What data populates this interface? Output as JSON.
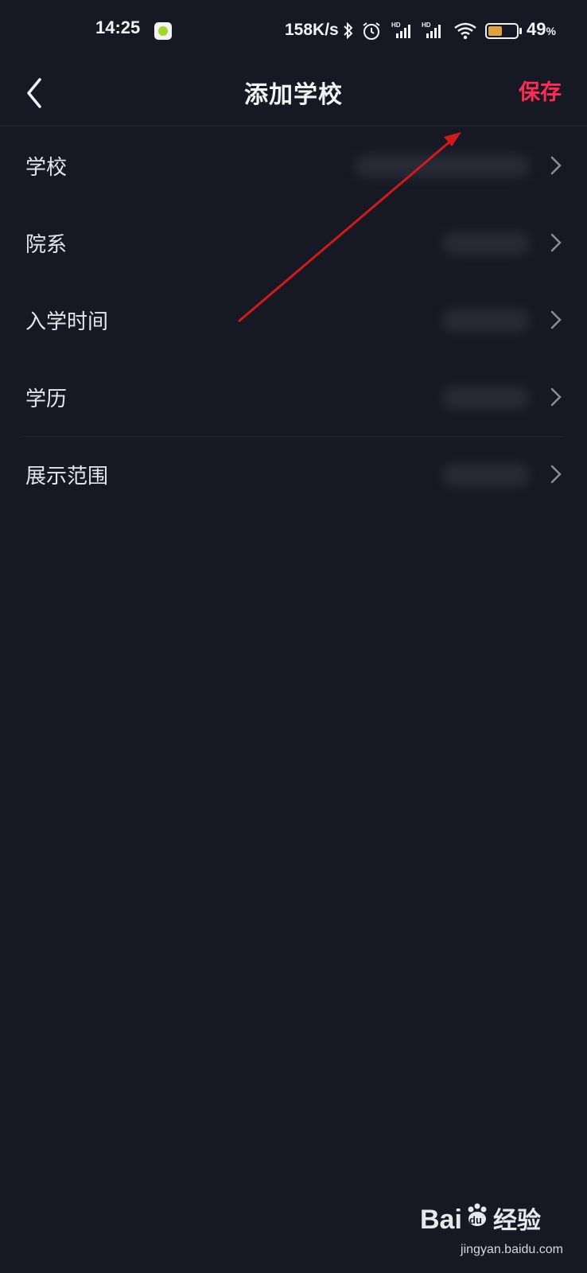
{
  "status_bar": {
    "time": "14:25",
    "network_speed": "158K/s",
    "battery_percent": "49",
    "battery_sign": "%",
    "battery_level": 0.49,
    "battery_color": "#e0a23a",
    "icons": [
      "app-notification-icon",
      "bluetooth-icon",
      "alarm-icon",
      "hd-signal-icon",
      "hd-signal-icon",
      "wifi-icon",
      "battery-icon"
    ]
  },
  "header": {
    "title": "添加学校",
    "save_label": "保存",
    "back_icon": "back-arrow-icon",
    "accent_color": "#fe2c55"
  },
  "rows": [
    {
      "label": "学校"
    },
    {
      "label": "院系"
    },
    {
      "label": "入学时间"
    },
    {
      "label": "学历"
    },
    {
      "label": "展示范围"
    }
  ],
  "watermark": {
    "logo_text_latin": "Bai",
    "logo_text_latin2": "du",
    "logo_text_cn": "经验",
    "url": "jingyan.baidu.com"
  },
  "annotation": {
    "color": "#d11a1a"
  }
}
